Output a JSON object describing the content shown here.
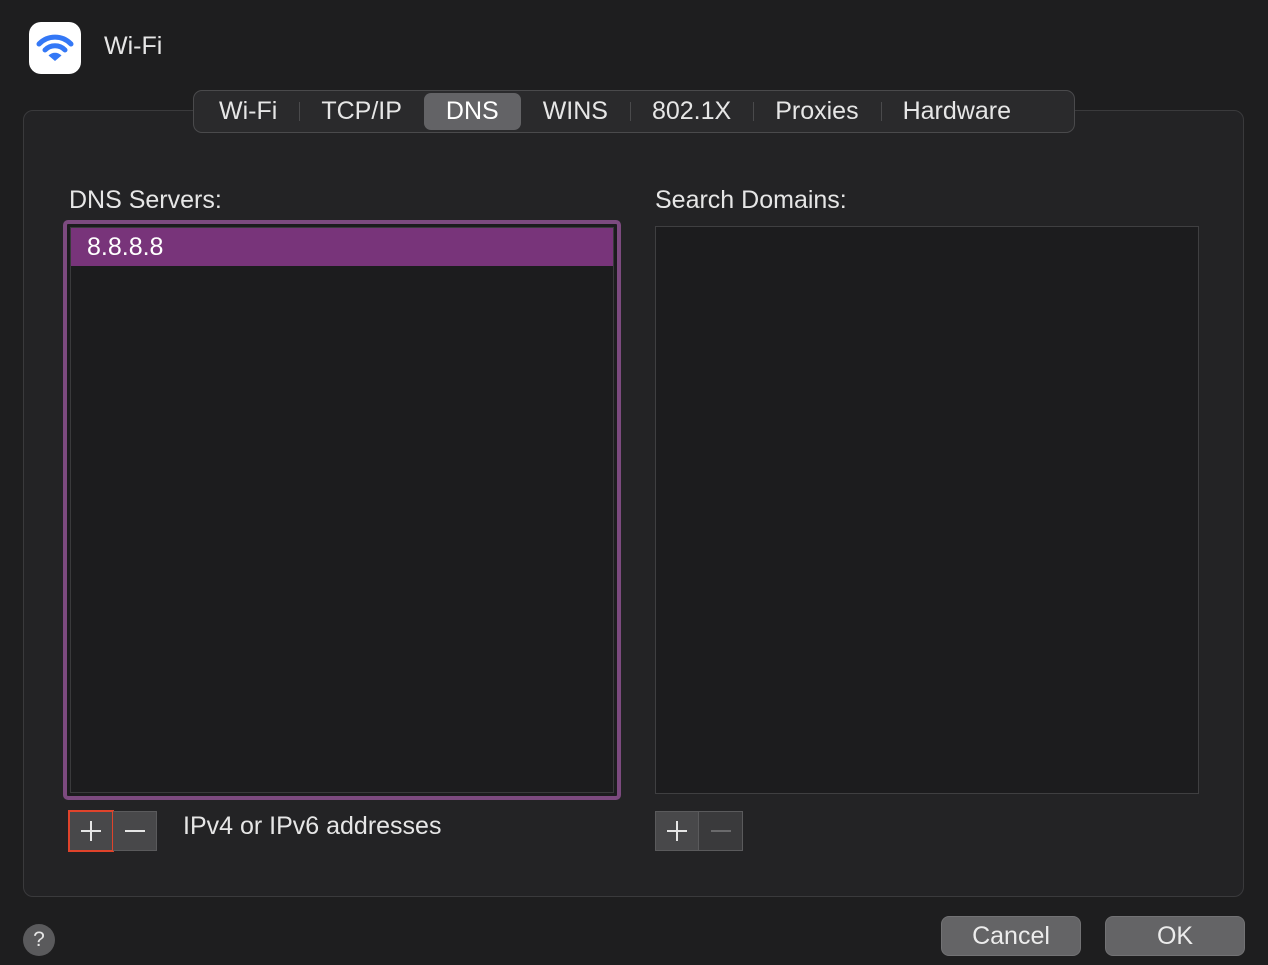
{
  "window": {
    "title": "Wi-Fi",
    "icon": "wifi-icon",
    "icon_color": "#3478f6"
  },
  "tabs": [
    {
      "label": "Wi-Fi"
    },
    {
      "label": "TCP/IP"
    },
    {
      "label": "DNS",
      "active": true
    },
    {
      "label": "WINS"
    },
    {
      "label": "802.1X"
    },
    {
      "label": "Proxies"
    },
    {
      "label": "Hardware"
    }
  ],
  "dns": {
    "label": "DNS Servers:",
    "servers": [
      "8.8.8.8"
    ],
    "selected": "8.8.8.8",
    "hint": "IPv4 or IPv6 addresses",
    "add_label": "+",
    "remove_label": "−"
  },
  "search_domains": {
    "label": "Search Domains:",
    "items": []
  },
  "footer": {
    "help_label": "?",
    "cancel_label": "Cancel",
    "ok_label": "OK"
  },
  "colors": {
    "selection": "#78347a",
    "focus_ring": "#7c4a7f",
    "add_button_highlight": "#e0432b"
  }
}
